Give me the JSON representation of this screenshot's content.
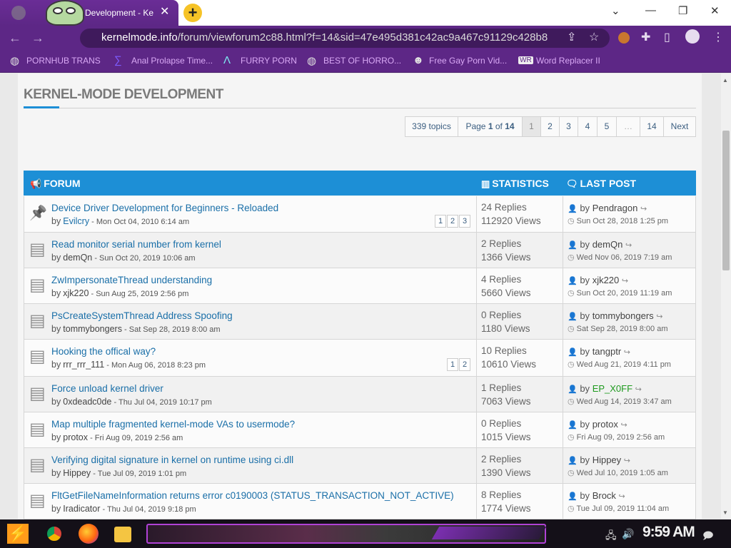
{
  "browser": {
    "tab_title": "Development - Ke",
    "tab_close": "✕",
    "new_tab": "+",
    "url_domain": "kernelmode.info",
    "url_path": "/forum/viewforum2c88.html?f=14&sid=47e495d381c42ac9a467c91129c428b8"
  },
  "bookmarks": [
    {
      "label": "PORNHUB TRANS"
    },
    {
      "label": "Anal Prolapse Time..."
    },
    {
      "label": "FURRY PORN"
    },
    {
      "label": "BEST OF HORRO..."
    },
    {
      "label": "Free Gay Porn Vid..."
    },
    {
      "label": "Word Replacer II"
    }
  ],
  "page": {
    "heading": "KERNEL-MODE DEVELOPMENT",
    "pagination": {
      "topic_count": "339 topics",
      "page_label": "Page",
      "page_current": "1",
      "page_of": "of",
      "page_total": "14",
      "pages": [
        "1",
        "2",
        "3",
        "4",
        "5",
        "…",
        "14"
      ],
      "next": "Next"
    },
    "table_header": {
      "forum": "FORUM",
      "statistics": "STATISTICS",
      "last_post": "LAST POST"
    },
    "labels": {
      "by": "by"
    },
    "topics": [
      {
        "icon": "pin-icon",
        "title": "Device Driver Development for Beginners - Reloaded",
        "author": "Evilcry",
        "date": "- Mon Oct 04, 2010 6:14 am",
        "pages": [
          "1",
          "2",
          "3"
        ],
        "replies": "24 Replies",
        "views": "112920 Views",
        "last_by": "Pendragon",
        "last_date": "Sun Oct 28, 2018 1:25 pm"
      },
      {
        "icon": "topic-icon",
        "title": "Read monitor serial number from kernel",
        "author": "demQn",
        "date": "- Sun Oct 20, 2019 10:06 am",
        "pages": [],
        "replies": "2 Replies",
        "views": "1366 Views",
        "last_by": "demQn",
        "last_date": "Wed Nov 06, 2019 7:19 am"
      },
      {
        "icon": "topic-icon",
        "title": "ZwImpersonateThread understanding",
        "author": "xjk220",
        "date": "- Sun Aug 25, 2019 2:56 pm",
        "pages": [],
        "replies": "4 Replies",
        "views": "5660 Views",
        "last_by": "xjk220",
        "last_date": "Sun Oct 20, 2019 11:19 am"
      },
      {
        "icon": "topic-icon",
        "title": "PsCreateSystemThread Address Spoofing",
        "author": "tommybongers",
        "date": "- Sat Sep 28, 2019 8:00 am",
        "pages": [],
        "replies": "0 Replies",
        "views": "1180 Views",
        "last_by": "tommybongers",
        "last_date": "Sat Sep 28, 2019 8:00 am"
      },
      {
        "icon": "topic-icon",
        "title": "Hooking the offical way?",
        "author": "rrr_rrr_111",
        "date": "- Mon Aug 06, 2018 8:23 pm",
        "pages": [
          "1",
          "2"
        ],
        "replies": "10 Replies",
        "views": "10610 Views",
        "last_by": "tangptr",
        "last_date": "Wed Aug 21, 2019 4:11 pm"
      },
      {
        "icon": "topic-icon",
        "title": "Force unload kernel driver",
        "author": "0xdeadc0de",
        "date": "- Thu Jul 04, 2019 10:17 pm",
        "pages": [],
        "replies": "1 Replies",
        "views": "7063 Views",
        "last_by": "EP_X0FF",
        "last_date": "Wed Aug 14, 2019 3:47 am"
      },
      {
        "icon": "topic-icon",
        "title": "Map multiple fragmented kernel-mode VAs to usermode?",
        "author": "protox",
        "date": "- Fri Aug 09, 2019 2:56 am",
        "pages": [],
        "replies": "0 Replies",
        "views": "1015 Views",
        "last_by": "protox",
        "last_date": "Fri Aug 09, 2019 2:56 am"
      },
      {
        "icon": "topic-icon",
        "title": "Verifying digital signature in kernel on runtime using ci.dll",
        "author": "Hippey",
        "date": "- Tue Jul 09, 2019 1:01 pm",
        "pages": [],
        "replies": "2 Replies",
        "views": "1390 Views",
        "last_by": "Hippey",
        "last_date": "Wed Jul 10, 2019 1:05 am"
      },
      {
        "icon": "topic-icon",
        "title": "FltGetFileNameInformation returns error c0190003 (STATUS_TRANSACTION_NOT_ACTIVE)",
        "author": "Iradicator",
        "date": "- Thu Jul 04, 2019 9:18 pm",
        "pages": [],
        "replies": "8 Replies",
        "views": "1774 Views",
        "last_by": "Brock",
        "last_date": "Tue Jul 09, 2019 11:04 am"
      }
    ]
  },
  "taskbar": {
    "clock": "9:59 AM"
  },
  "colors": {
    "chrome_purple": "#5d2786",
    "forum_blue": "#1d8fd6",
    "link_blue": "#1a6fa8",
    "moderator_green": "#1e9a1e"
  }
}
